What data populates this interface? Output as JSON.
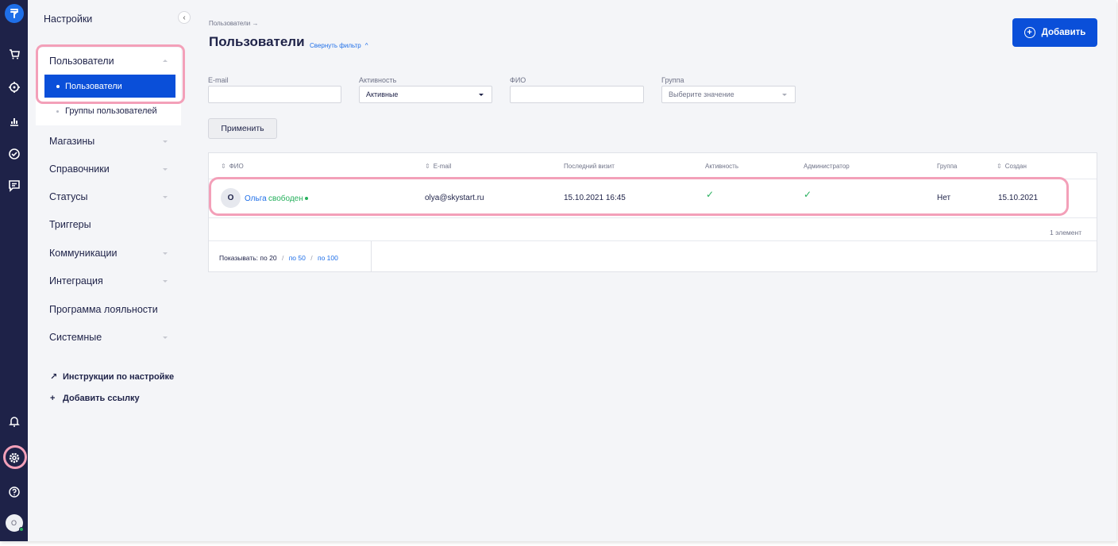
{
  "colors": {
    "rail": "#1e2248",
    "accent": "#0a4fd9",
    "link": "#1f6fe8",
    "success": "#27b05d",
    "highlight": "#f3a0b9",
    "background": "#f4f5f8"
  },
  "rail": {
    "icons": [
      "logo-icon",
      "cart-icon",
      "target-icon",
      "chart-icon",
      "check-circle-icon",
      "chat-icon",
      "bell-icon",
      "settings-icon",
      "help-icon"
    ],
    "avatar_initial": "O"
  },
  "sidebar": {
    "title": "Настройки",
    "collapse_glyph": "‹",
    "sections": [
      {
        "label": "Пользователи",
        "expanded": true
      },
      {
        "label": "Магазины"
      },
      {
        "label": "Справочники"
      },
      {
        "label": "Статусы"
      },
      {
        "label": "Триггеры"
      },
      {
        "label": "Коммуникации"
      },
      {
        "label": "Интеграция"
      },
      {
        "label": "Программа лояльности"
      },
      {
        "label": "Системные"
      }
    ],
    "sub_items": [
      {
        "label": "Пользователи",
        "active": true
      },
      {
        "label": "Группы пользователей"
      }
    ],
    "links": [
      {
        "glyph": "↗",
        "label": "Инструкции по настройке",
        "icon": "arrow-up-right-icon"
      },
      {
        "glyph": "+",
        "label": "Добавить ссылку",
        "icon": "plus-icon"
      }
    ]
  },
  "header": {
    "breadcrumb": "Пользователи →",
    "title": "Пользователи",
    "toggle_filter": "Свернуть фильтр",
    "toggle_glyph": "^",
    "add_button": "Добавить",
    "add_glyph": "+"
  },
  "filters": {
    "email_label": "E-mail",
    "email_value": "",
    "activity_label": "Активность",
    "activity_value": "Активные",
    "fio_label": "ФИО",
    "fio_value": "",
    "group_label": "Группа",
    "group_placeholder": "Выберите значение",
    "apply_button": "Применить"
  },
  "table": {
    "sort_glyph": "⇕",
    "columns": [
      "ФИО",
      "E-mail",
      "Последний визит",
      "Активность",
      "Администратор",
      "Группа",
      "Создан"
    ],
    "rows": [
      {
        "initial": "О",
        "name": "Ольга",
        "status": "свободен",
        "email": "olya@skystart.ru",
        "last_visit": "15.10.2021 16:45",
        "active": "✓",
        "admin": "✓",
        "group": "Нет",
        "created": "15.10.2021"
      }
    ],
    "count_text": "1 элемент"
  },
  "pagination": {
    "label": "Показывать:",
    "current": "по 20",
    "options": [
      "по 50",
      "по 100"
    ],
    "separator": "/"
  }
}
